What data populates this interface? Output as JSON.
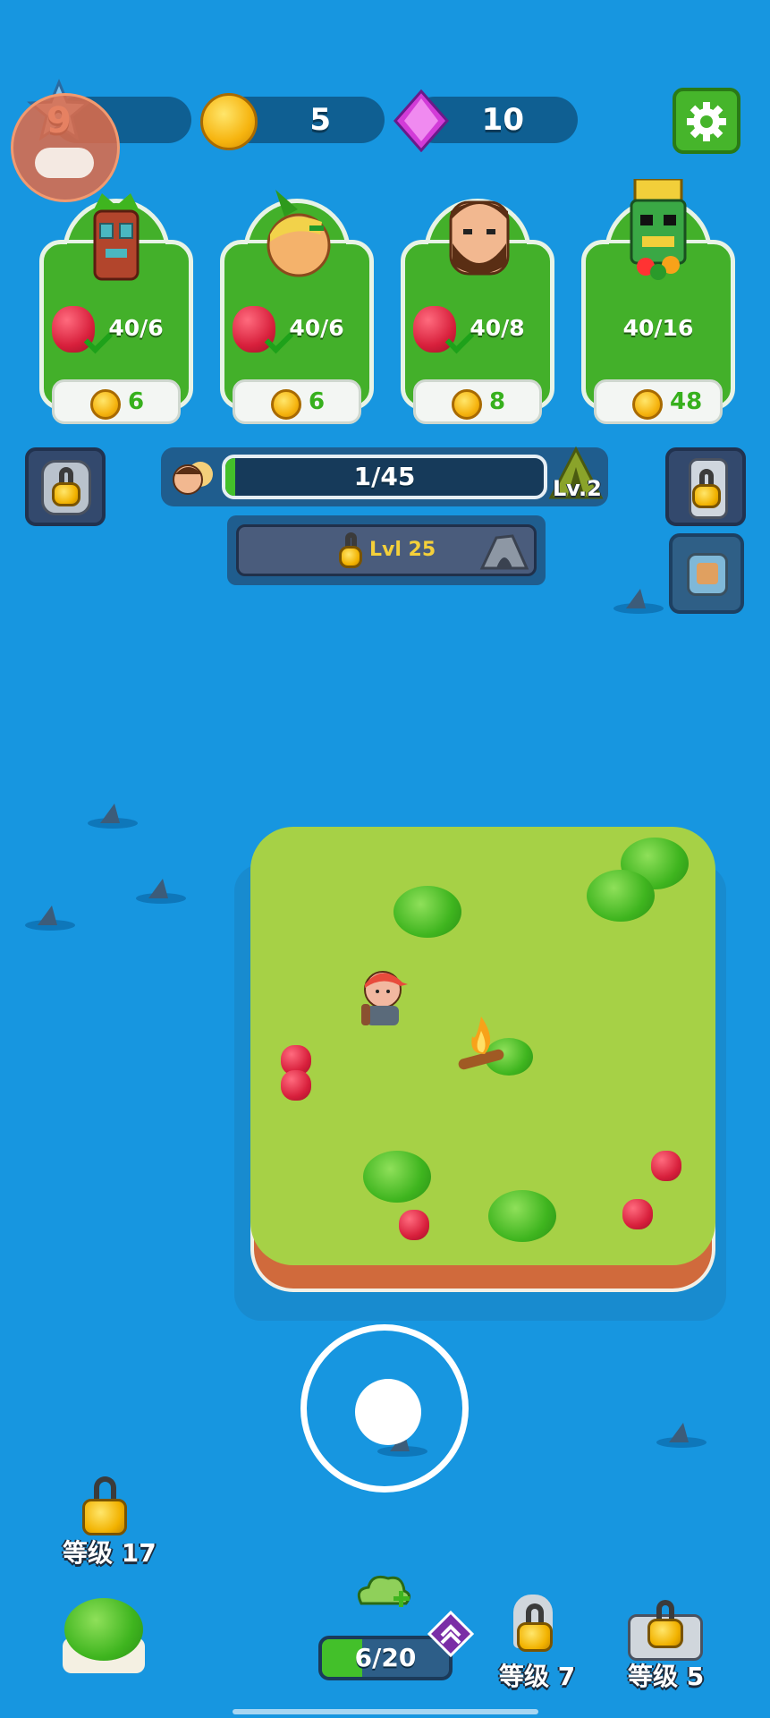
{
  "hud": {
    "level": "9",
    "coins": "5",
    "gems": "10"
  },
  "cards": [
    {
      "name": "tiki-mask",
      "count": "40/6",
      "price": "6",
      "has_berry": true
    },
    {
      "name": "pineapple-head",
      "count": "40/6",
      "price": "6",
      "has_berry": true
    },
    {
      "name": "bearded-man",
      "count": "40/8",
      "price": "8",
      "has_berry": true
    },
    {
      "name": "totem",
      "count": "40/16",
      "price": "48",
      "has_berry": false
    }
  ],
  "progress": {
    "text": "1/45",
    "fraction": 0.022,
    "level_badge": "Lv.2",
    "lock_label": "Lvl 25"
  },
  "bottom": {
    "left_unlock": "等级 17",
    "capacity": "6/20",
    "mid_unlock": "等级 7",
    "right_unlock": "等级 5"
  },
  "colors": {
    "water": "#1796e0",
    "grass": "#a6d146",
    "card_green": "#43b02a",
    "gem": "#d23bd8"
  },
  "icons": [
    "gear-icon",
    "gamepad-icon",
    "coin-icon",
    "gem-icon",
    "lock-icon",
    "backpack-icon",
    "tent-icon",
    "campfire-icon",
    "cloud-plus-icon",
    "double-chevron-up-icon"
  ]
}
